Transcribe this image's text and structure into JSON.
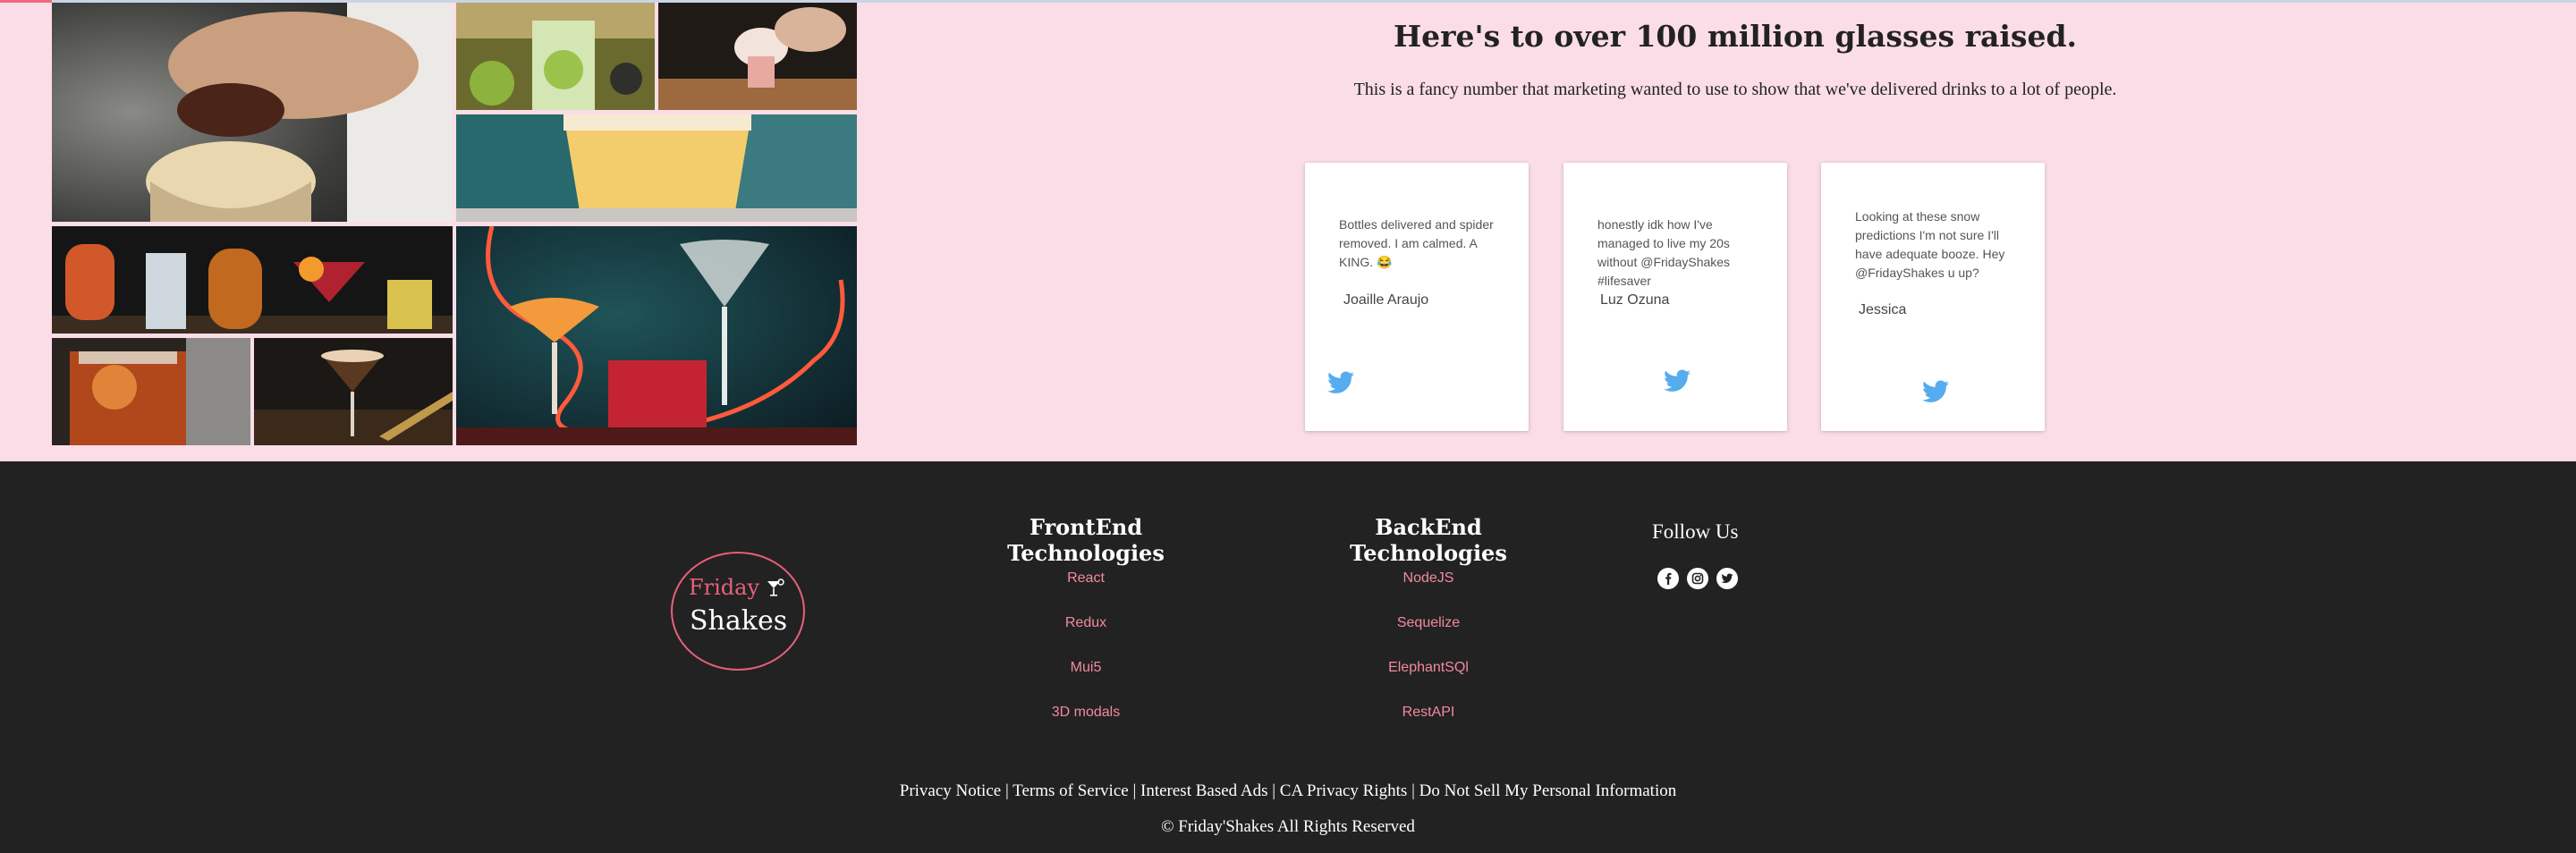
{
  "page": {
    "heading": "Here's to over 100 million glasses raised.",
    "subheading": "This is a fancy number that marketing wanted to use to show that we've delivered drinks to a lot of people.",
    "progress_percent": 2
  },
  "gallery": {
    "photos": [
      "pouring cocktail photo",
      "mojito photo",
      "pink cocktail photo",
      "pale ale glass photo",
      "aperitif row photo",
      "neon cocktails photo",
      "old fashioned photo",
      "espresso martini photo"
    ]
  },
  "testimonials": [
    {
      "quote": "Bottles delivered and spider removed. I am calmed. A KING. 😂",
      "author": "Joaille Araujo",
      "icon": "twitter-icon"
    },
    {
      "quote": "honestly idk how I've managed to live my 20s without @FridayShakes #lifesaver",
      "author": "Luz Ozuna",
      "icon": "twitter-icon"
    },
    {
      "quote": "Looking at these snow predictions I'm not sure I'll have adequate booze. Hey @FridayShakes u up?",
      "author": "Jessica",
      "icon": "twitter-icon"
    }
  ],
  "footer": {
    "logo": {
      "word1": "Friday",
      "word2": "Shakes"
    },
    "frontend": {
      "title": "FrontEnd Technologies",
      "links": [
        "React",
        "Redux",
        "Mui5",
        "3D modals"
      ]
    },
    "backend": {
      "title": "BackEnd Technologies",
      "links": [
        "NodeJS",
        "Sequelize",
        "ElephantSQl",
        "RestAPI"
      ]
    },
    "follow": {
      "title": "Follow Us",
      "icons": [
        "facebook-icon",
        "instagram-icon",
        "twitter-icon"
      ]
    },
    "legal": {
      "privacy": "Privacy Notice",
      "terms": "Terms of Service",
      "ads": "Interest Based Ads",
      "ca": "CA Privacy Rights",
      "dns": "Do Not Sell My Personal Information",
      "separator": "|"
    },
    "copyright": "© Friday'Shakes All Rights Reserved"
  },
  "colors": {
    "background": "#fbdde8",
    "footer": "#222222",
    "accent": "#e8607a",
    "link": "#f28aa0",
    "twitter": "#55acee"
  }
}
